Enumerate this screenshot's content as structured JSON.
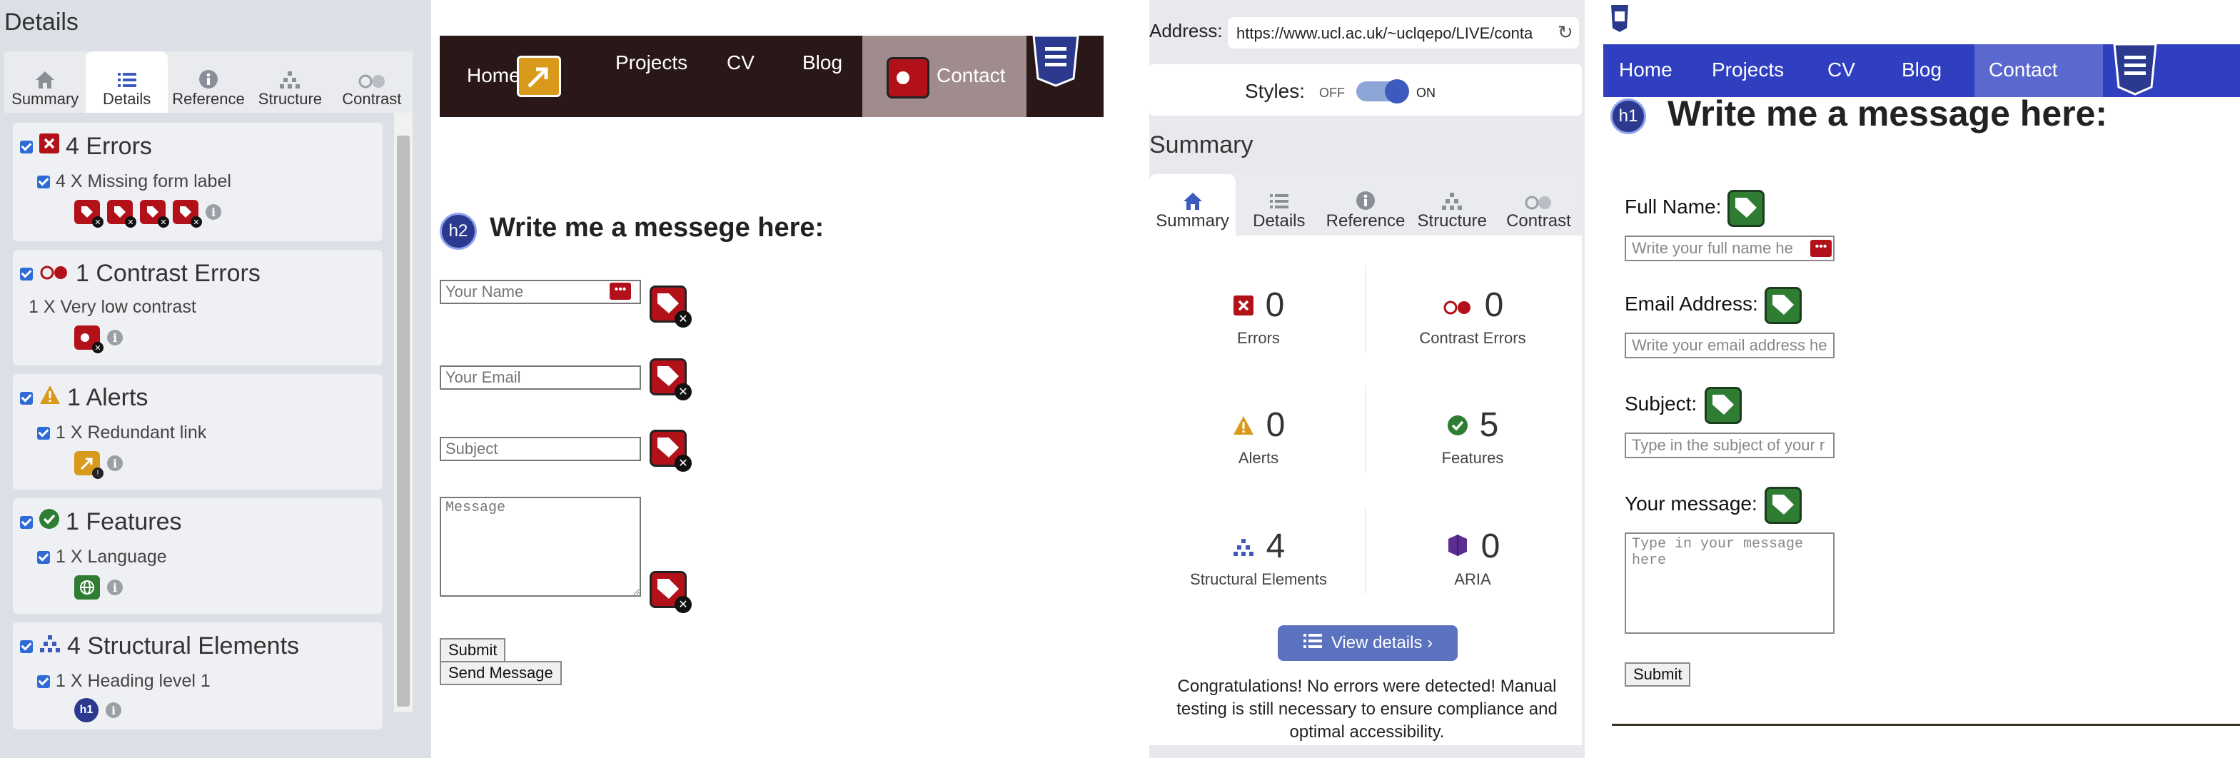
{
  "left_panel": {
    "title": "Details",
    "tabs": [
      {
        "label": "Summary",
        "icon": "home-icon"
      },
      {
        "label": "Details",
        "icon": "list-icon"
      },
      {
        "label": "Reference",
        "icon": "info-icon"
      },
      {
        "label": "Structure",
        "icon": "hierarchy-icon"
      },
      {
        "label": "Contrast",
        "icon": "contrast-icon"
      }
    ],
    "active_tab": "Details",
    "categories": [
      {
        "title": "4 Errors",
        "item": "4 X Missing form label"
      },
      {
        "title": "1 Contrast Errors",
        "item": "1 X Very low contrast"
      },
      {
        "title": "1 Alerts",
        "item": "1 X Redundant link"
      },
      {
        "title": "1 Features",
        "item": "1 X Language"
      },
      {
        "title": "4 Structural Elements",
        "item": "1 X Heading level 1"
      }
    ],
    "h1_badge": "h1"
  },
  "page1": {
    "nav": {
      "home": "Home",
      "projects": "Projects",
      "cv": "CV",
      "blog": "Blog",
      "contact": "Contact"
    },
    "heading_badge": "h2",
    "heading": "Write me a messege here:",
    "fields": {
      "name": "Your Name",
      "email": "Your Email",
      "subject": "Subject",
      "message": "Message"
    },
    "submit": "Submit",
    "send": "Send Message"
  },
  "mid_panel": {
    "address_label": "Address:",
    "address_value": "https://www.ucl.ac.uk/~uclqepo/LIVE/conta",
    "styles_label": "Styles:",
    "styles_off": "OFF",
    "styles_on": "ON",
    "title": "Summary",
    "tabs": [
      {
        "label": "Summary",
        "icon": "home-icon"
      },
      {
        "label": "Details",
        "icon": "list-icon"
      },
      {
        "label": "Reference",
        "icon": "info-icon"
      },
      {
        "label": "Structure",
        "icon": "hierarchy-icon"
      },
      {
        "label": "Contrast",
        "icon": "contrast-icon"
      }
    ],
    "active_tab": "Summary",
    "stats": [
      {
        "value": "0",
        "label": "Errors"
      },
      {
        "value": "0",
        "label": "Contrast Errors"
      },
      {
        "value": "0",
        "label": "Alerts"
      },
      {
        "value": "5",
        "label": "Features"
      },
      {
        "value": "4",
        "label": "Structural Elements"
      },
      {
        "value": "0",
        "label": "ARIA"
      }
    ],
    "view_details": "View details ›",
    "congrats": "Congratulations! No errors were detected! Manual testing is still necessary to ensure compliance and optimal accessibility."
  },
  "page2": {
    "nav": {
      "home": "Home",
      "projects": "Projects",
      "cv": "CV",
      "blog": "Blog",
      "contact": "Contact"
    },
    "heading_badge": "h1",
    "heading": "Write me a message here:",
    "fields": {
      "name_label": "Full Name:",
      "name_placeholder": "Write your full name he",
      "email_label": "Email Address:",
      "email_placeholder": "Write your email address he",
      "subject_label": "Subject:",
      "subject_placeholder": "Type in the subject of your r",
      "message_label": "Your message:",
      "message_placeholder": "Type in your message here"
    },
    "submit": "Submit"
  },
  "colors": {
    "error": "#b3111a",
    "feature": "#2e7d32",
    "structure": "#3d5bbf",
    "alert": "#d99a1b",
    "nav_dark": "#2a1818",
    "nav_blue": "#2f3fbf"
  }
}
